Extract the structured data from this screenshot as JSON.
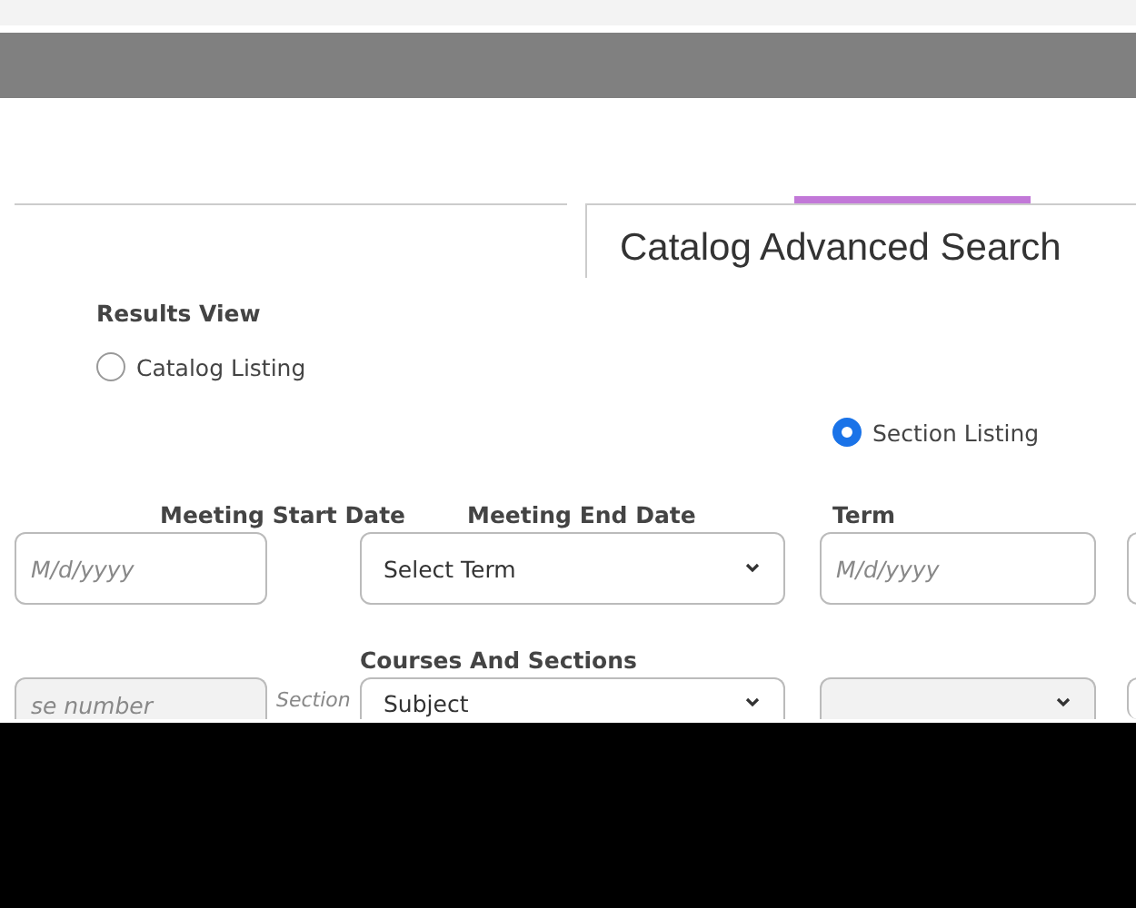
{
  "heading": "Catalog Advanced Search",
  "results_view": {
    "label": "Results View",
    "options": [
      {
        "label": "Catalog Listing",
        "selected": false
      },
      {
        "label": "Section Listing",
        "selected": true
      }
    ]
  },
  "date_labels": [
    "Meeting Start Date",
    "Meeting End Date",
    "Term"
  ],
  "date_fields": [
    {
      "kind": "input",
      "placeholder": "M/d/yyyy"
    },
    {
      "kind": "select",
      "value": "Select Term"
    },
    {
      "kind": "input",
      "placeholder": "M/d/yyyy"
    }
  ],
  "courses_label": "Courses And Sections",
  "course_fields": [
    {
      "kind": "input",
      "placeholder": "se number"
    },
    {
      "kind": "select",
      "value": "Subject"
    },
    {
      "kind": "select"
    }
  ],
  "section_label": "Section"
}
